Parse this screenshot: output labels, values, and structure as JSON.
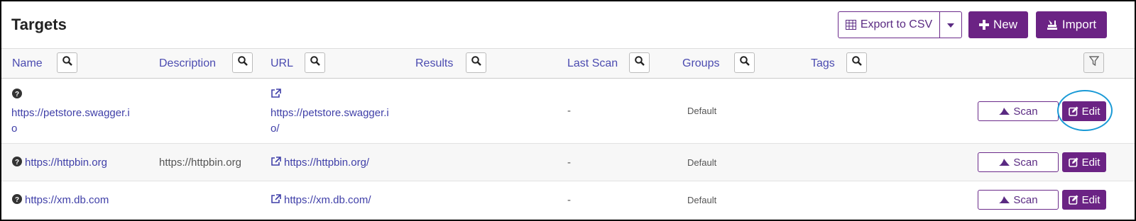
{
  "page": {
    "title": "Targets"
  },
  "toolbar": {
    "export_label": "Export to CSV",
    "new_label": "New",
    "import_label": "Import"
  },
  "columns": {
    "name": "Name",
    "description": "Description",
    "url": "URL",
    "results": "Results",
    "last_scan": "Last Scan",
    "groups": "Groups",
    "tags": "Tags"
  },
  "rows": [
    {
      "name_line1": "https://petstore.swagger.i",
      "name_line2": "o",
      "description": "",
      "url_line1": "https://petstore.swagger.i",
      "url_line2": "o/",
      "last_scan": "-",
      "group": "Default",
      "scan_label": "Scan",
      "edit_label": "Edit"
    },
    {
      "name": "https://httpbin.org",
      "description": "https://httpbin.org",
      "url": "https://httpbin.org/",
      "last_scan": "-",
      "group": "Default",
      "scan_label": "Scan",
      "edit_label": "Edit"
    },
    {
      "name": "https://xm.db.com",
      "description": "",
      "url": "https://xm.db.com/",
      "last_scan": "-",
      "group": "Default",
      "scan_label": "Scan",
      "edit_label": "Edit"
    }
  ],
  "colors": {
    "accent": "#6b2384",
    "link": "#3f3fa8",
    "highlight": "#1a9ad6"
  }
}
